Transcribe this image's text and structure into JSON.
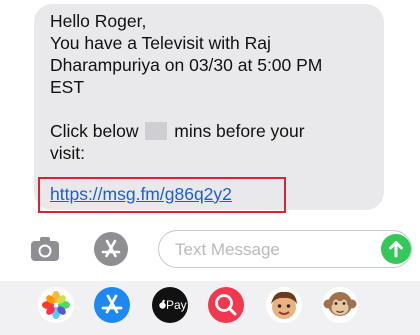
{
  "message": {
    "greeting": "Hello Roger,",
    "line2": "You have a Televisit with Raj",
    "line3": "Dharampuriya on 03/30 at 5:00 PM",
    "line4": "EST",
    "click_prefix": "Click below",
    "click_suffix": "mins before your",
    "visit": "visit:",
    "link": "https://msg.fm/g86q2y2"
  },
  "compose": {
    "placeholder": "Text Message"
  },
  "drawer": {
    "apple_pay_label": "Pay"
  },
  "colors": {
    "bubble": "#e9e9eb",
    "link": "#1a5fd1",
    "highlight_box": "#d6252f",
    "send": "#34c759"
  },
  "icons": [
    "camera-icon",
    "app-store-icon",
    "arrow-up-icon",
    "photos-icon",
    "app-store-icon",
    "apple-pay-icon",
    "search-images-icon",
    "memoji-icon",
    "monkey-sticker-icon"
  ]
}
